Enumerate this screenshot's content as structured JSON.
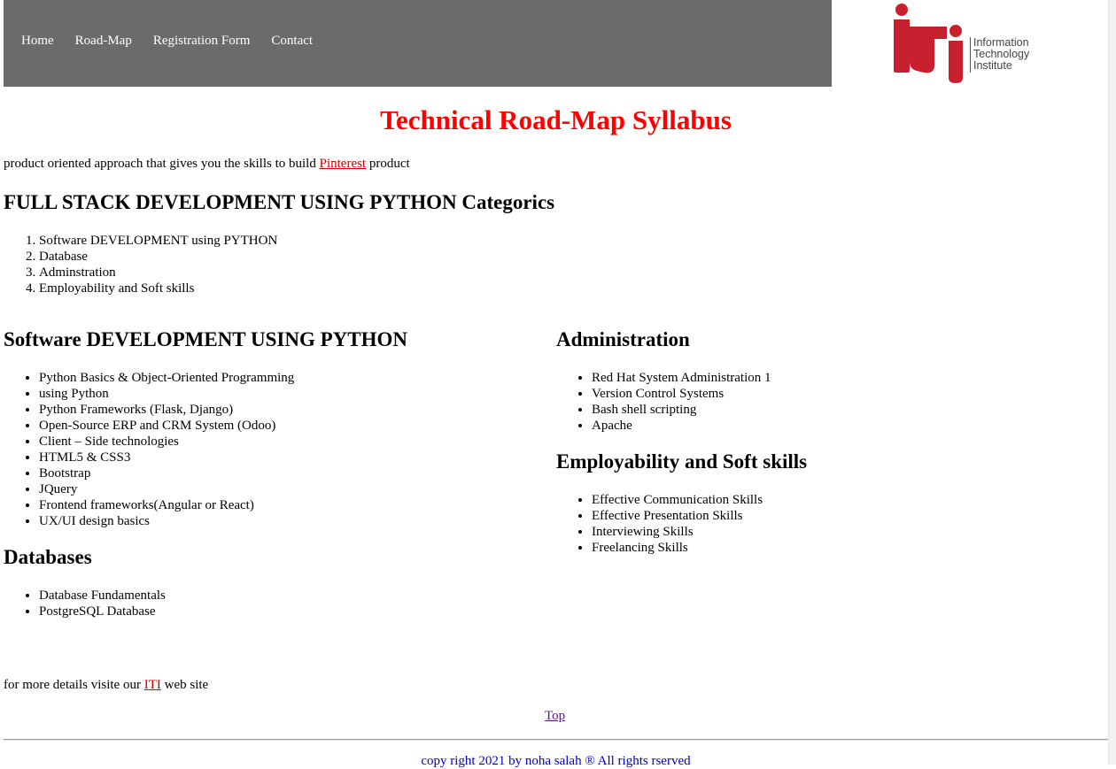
{
  "nav": {
    "items": [
      "Home",
      "Road-Map",
      "Registration Form",
      "Contact"
    ]
  },
  "logo": {
    "line1": "Information",
    "line2": "Technology",
    "line3": "Institute",
    "brand_color": "#c8202e"
  },
  "page": {
    "title": "Technical Road-Map Syllabus",
    "intro_before": "product oriented approach that gives you the skills to build ",
    "intro_link": "Pinterest",
    "intro_after": " product",
    "title_color": "#ff0000"
  },
  "categories": {
    "heading": "FULL STACK DEVELOPMENT USING PYTHON Categorics",
    "items": [
      "Software DEVELOPMENT using PYTHON",
      "Database",
      "Adminstration",
      "Employability and Soft skills"
    ]
  },
  "software": {
    "heading": "Software DEVELOPMENT USING PYTHON",
    "items": [
      "Python Basics & Object-Oriented Programming",
      "using Python",
      "Python Frameworks (Flask, Django)",
      "Open-Source ERP and CRM System (Odoo)",
      "Client – Side technologies",
      "HTML5 & CSS3",
      "Bootstrap",
      "JQuery",
      "Frontend frameworks(Angular or React)",
      "UX/UI design basics"
    ]
  },
  "databases": {
    "heading": "Databases",
    "items": [
      "Database Fundamentals",
      "PostgreSQL Database"
    ]
  },
  "administration": {
    "heading": "Administration",
    "items": [
      "Red Hat System Administration 1",
      "Version Control Systems",
      "Bash shell scripting",
      "Apache"
    ]
  },
  "employability": {
    "heading": "Employability and Soft skills",
    "items": [
      "Effective Communication Skills",
      "Effective Presentation Skills",
      "Interviewing Skills",
      "Freelancing Skills"
    ]
  },
  "footer": {
    "details_before": "for more details visite our ",
    "details_link": "ITI",
    "details_after": " web site",
    "top_link": "Top",
    "copyright": "copy right 2021 by noha salah ® All rights rserved"
  }
}
